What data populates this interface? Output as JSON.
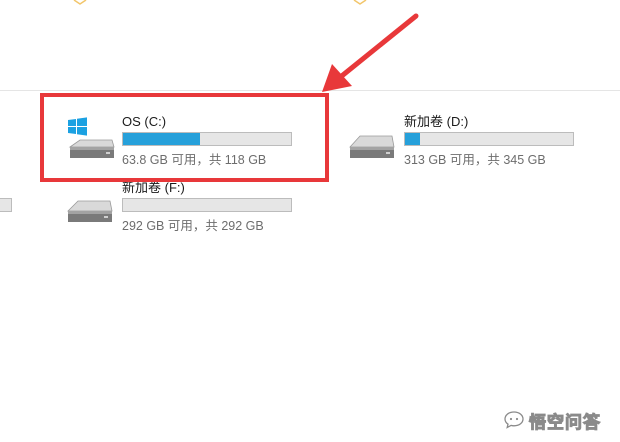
{
  "drives": [
    {
      "id": "c",
      "name": "OS (C:)",
      "size_text": "63.8 GB 可用，共 118 GB",
      "used_fraction": 0.46,
      "icon": "windows-system-drive-icon"
    },
    {
      "id": "d",
      "name": "新加卷 (D:)",
      "size_text": "313 GB 可用，共 345 GB",
      "used_fraction": 0.09,
      "icon": "hard-drive-icon"
    },
    {
      "id": "f",
      "name": "新加卷 (F:)",
      "size_text": "292 GB 可用，共 292 GB",
      "used_fraction": 0.0,
      "icon": "hard-drive-icon"
    }
  ],
  "watermark": {
    "text": "悟空问答",
    "icon": "chat-bubble-icon"
  },
  "colors": {
    "bar_fill": "#26a0da",
    "bar_track": "#e6e6e6",
    "highlight": "#e8383a",
    "windows_logo": "#1ba1e2"
  }
}
